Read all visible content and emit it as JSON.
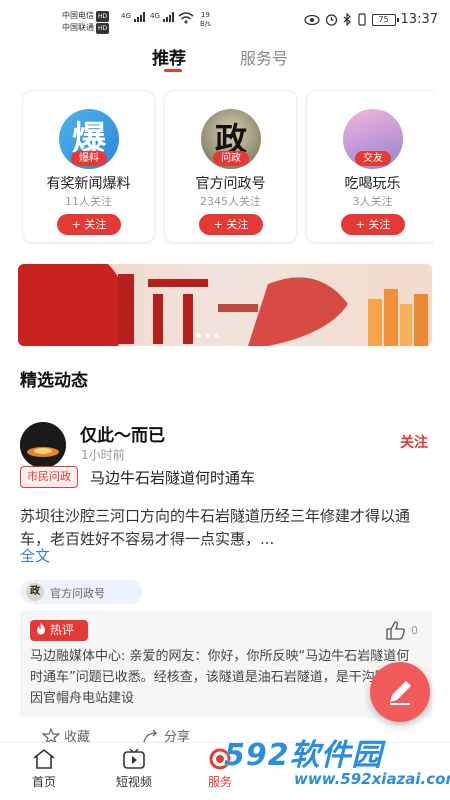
{
  "status_bar": {
    "carrier1": "中国电信",
    "carrier2": "中国联通",
    "hd": "HD",
    "signal1": "4G",
    "signal2": "4G",
    "net_speed_value": "19",
    "net_speed_unit": "B/s",
    "battery": "75",
    "time": "13:37"
  },
  "top_tabs": {
    "recommend": "推荐",
    "service": "服务号"
  },
  "cards": [
    {
      "tag": "爆料",
      "name": "有奖新闻爆料",
      "fans": "11人关注",
      "follow": "+ 关注",
      "icon_char": "爆"
    },
    {
      "tag": "问政",
      "name": "官方问政号",
      "fans": "2345人关注",
      "follow": "+ 关注",
      "icon_char": "政"
    },
    {
      "tag": "交友",
      "name": "吃喝玩乐",
      "fans": "3人关注",
      "follow": "+ 关注"
    }
  ],
  "section_title": "精选动态",
  "post": {
    "author": "仅此～而已",
    "time": "1小时前",
    "follow": "关注",
    "topic_tag": "市民问政",
    "topic_title": "马边牛石岩隧道何时通车",
    "body": "苏坝往沙腔三河口方向的牛石岩隧道历经三年修建才得以通车，老百姓好不容易才得一点实惠，...",
    "read_full": "全文",
    "source": "官方问政号",
    "source_icon": "政"
  },
  "hot_comment": {
    "badge": "热评",
    "likes": "0",
    "who": "马边融媒体中心:",
    "text": " 亲爱的网友：你好，你所反映“马边牛石岩隧道何时通车”问题已收悉。经核查，该隧道是油石岩隧道，是干沟隧道，因官帽舟电站建设"
  },
  "actions": {
    "collect": "收藏",
    "share": "分享"
  },
  "bottom_nav": {
    "home": "首页",
    "video": "短视频",
    "service": "服务"
  },
  "watermark": {
    "main": "592软件园",
    "url": "www.592xiazai.com"
  }
}
